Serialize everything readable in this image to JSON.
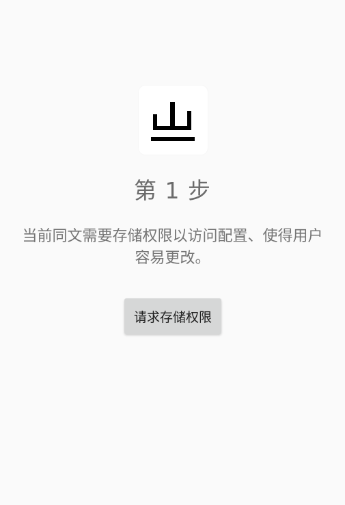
{
  "app": {
    "icon": "app-logo-icon",
    "icon_color": "#000000"
  },
  "step": {
    "title": "第 1 步",
    "description": "当前同文需要存储权限以访问配置、使得用户容易更改。"
  },
  "actions": {
    "request_permission_label": "请求存储权限"
  },
  "colors": {
    "background": "#fafafa",
    "title_text": "#6b6b6b",
    "body_text": "#757575",
    "button_background": "#d6d7d7",
    "button_text": "#202020"
  }
}
